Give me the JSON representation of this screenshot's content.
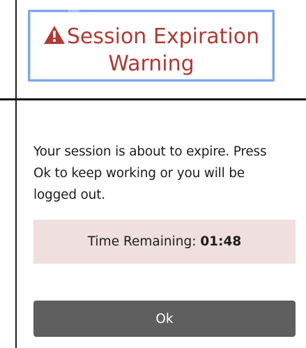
{
  "dialog": {
    "title": "Session Expiration Warning",
    "icon": "warning-triangle-icon",
    "message": "Your session is about to expire. Press Ok to keep working or you will be logged out.",
    "timer": {
      "label": "Time Remaining:",
      "value": "01:48"
    },
    "ok_label": "Ok"
  },
  "colors": {
    "title": "#b03a34",
    "header_border": "#7aa7e8",
    "timer_background": "#efdfdf",
    "button_background": "#5f5f5f"
  }
}
